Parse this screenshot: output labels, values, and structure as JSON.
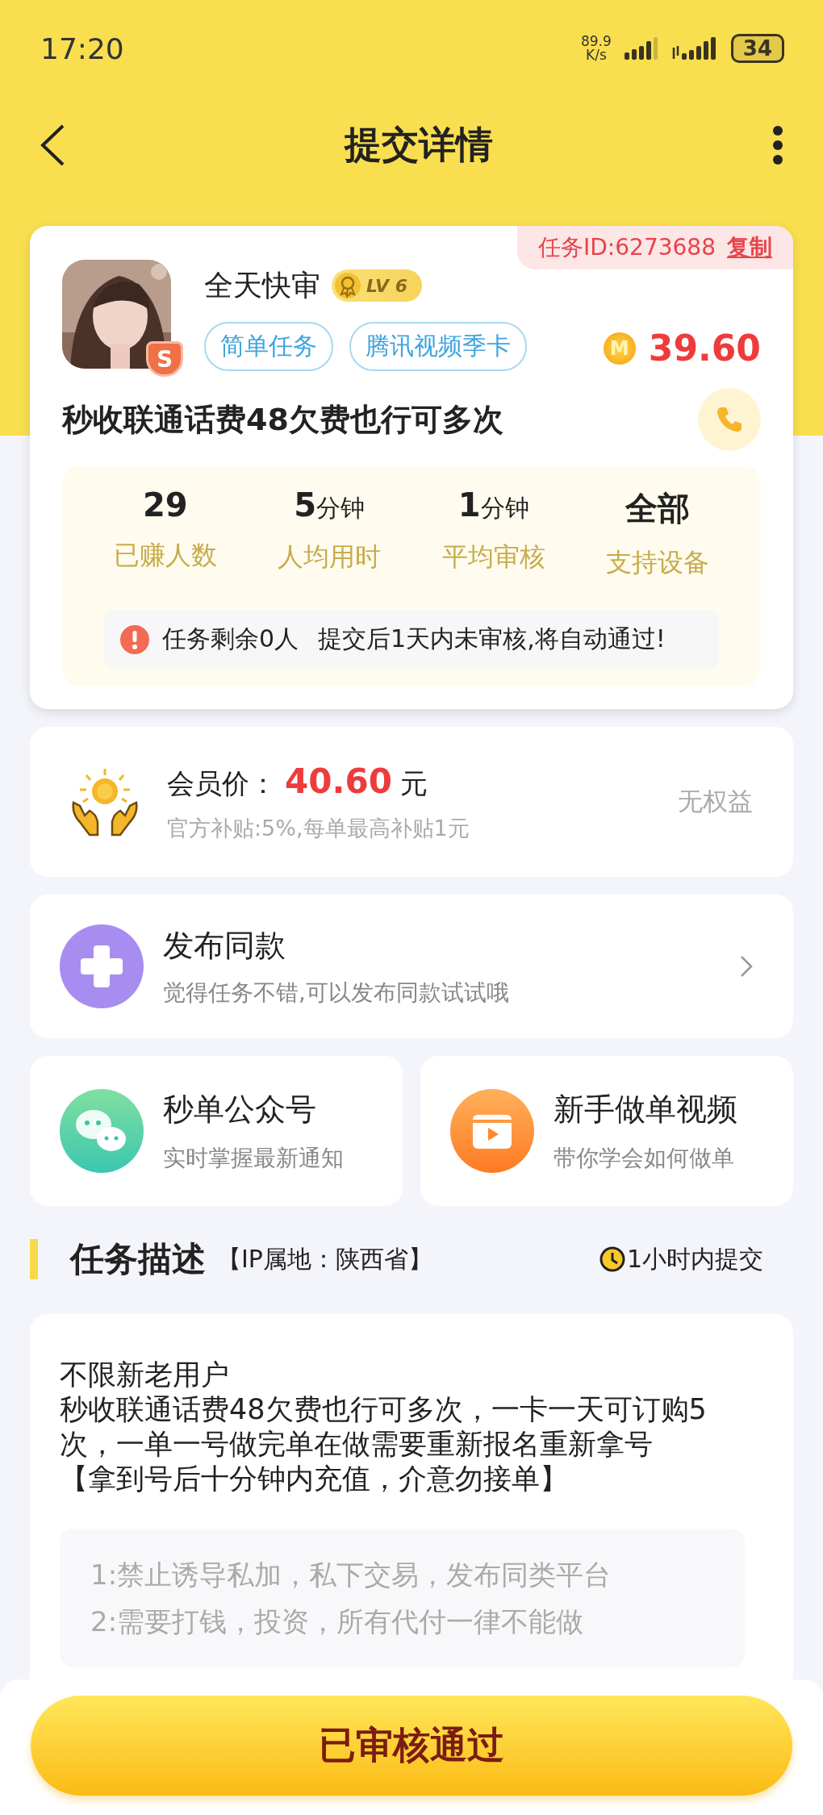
{
  "status_bar": {
    "time": "17:20",
    "net_speed": "89.9",
    "net_unit": "K/s",
    "battery": "34"
  },
  "nav": {
    "title": "提交详情"
  },
  "task": {
    "id_label": "任务ID:6273688",
    "copy": "复制",
    "avatar": {
      "kind": "picture",
      "rank_badge": "S"
    },
    "publisher": "全天快审",
    "level": "LV 6",
    "tags": [
      "简单任务",
      "腾讯视频季卡"
    ],
    "coin_mark": "M",
    "reward": "39.60",
    "title": "秒收联通话费48欠费也行可多次",
    "stats": [
      {
        "value": "29",
        "label": "已赚人数"
      },
      {
        "value": "5",
        "unit": "分钟",
        "label": "人均用时"
      },
      {
        "value": "1",
        "unit": "分钟",
        "label": "平均审核"
      },
      {
        "value": "全部",
        "label": "支持设备"
      }
    ],
    "notice": [
      "任务剩余0人",
      "提交后1天内未审核,将自动通过!"
    ]
  },
  "member": {
    "label": "会员价：",
    "price": "40.60",
    "unit": "元",
    "subsidy": "官方补贴:5%,每单最高补贴1元",
    "benefit": "无权益"
  },
  "publish": {
    "title": "发布同款",
    "subtitle": "觉得任务不错,可以发布同款试试哦"
  },
  "links": [
    {
      "kind": "wechat",
      "title": "秒单公众号",
      "subtitle": "实时掌握最新通知"
    },
    {
      "kind": "video",
      "title": "新手做单视频",
      "subtitle": "带你学会如何做单"
    }
  ],
  "description": {
    "heading": "任务描述",
    "ip": "【IP属地：陕西省】",
    "deadline": "1小时内提交",
    "lines": [
      "不限新老用户",
      "秒收联通话费48欠费也行可多次，一卡一天可订购5次，一单一号做完单在做需要重新报名重新拿号",
      "【拿到号后十分钟内充值，介意勿接单】"
    ],
    "rules": [
      "1:禁止诱导私加，私下交易，发布同类平台",
      "2:需要打钱，投资，所有代付一律不能做"
    ]
  },
  "bottom": {
    "button": "已审核通过"
  }
}
